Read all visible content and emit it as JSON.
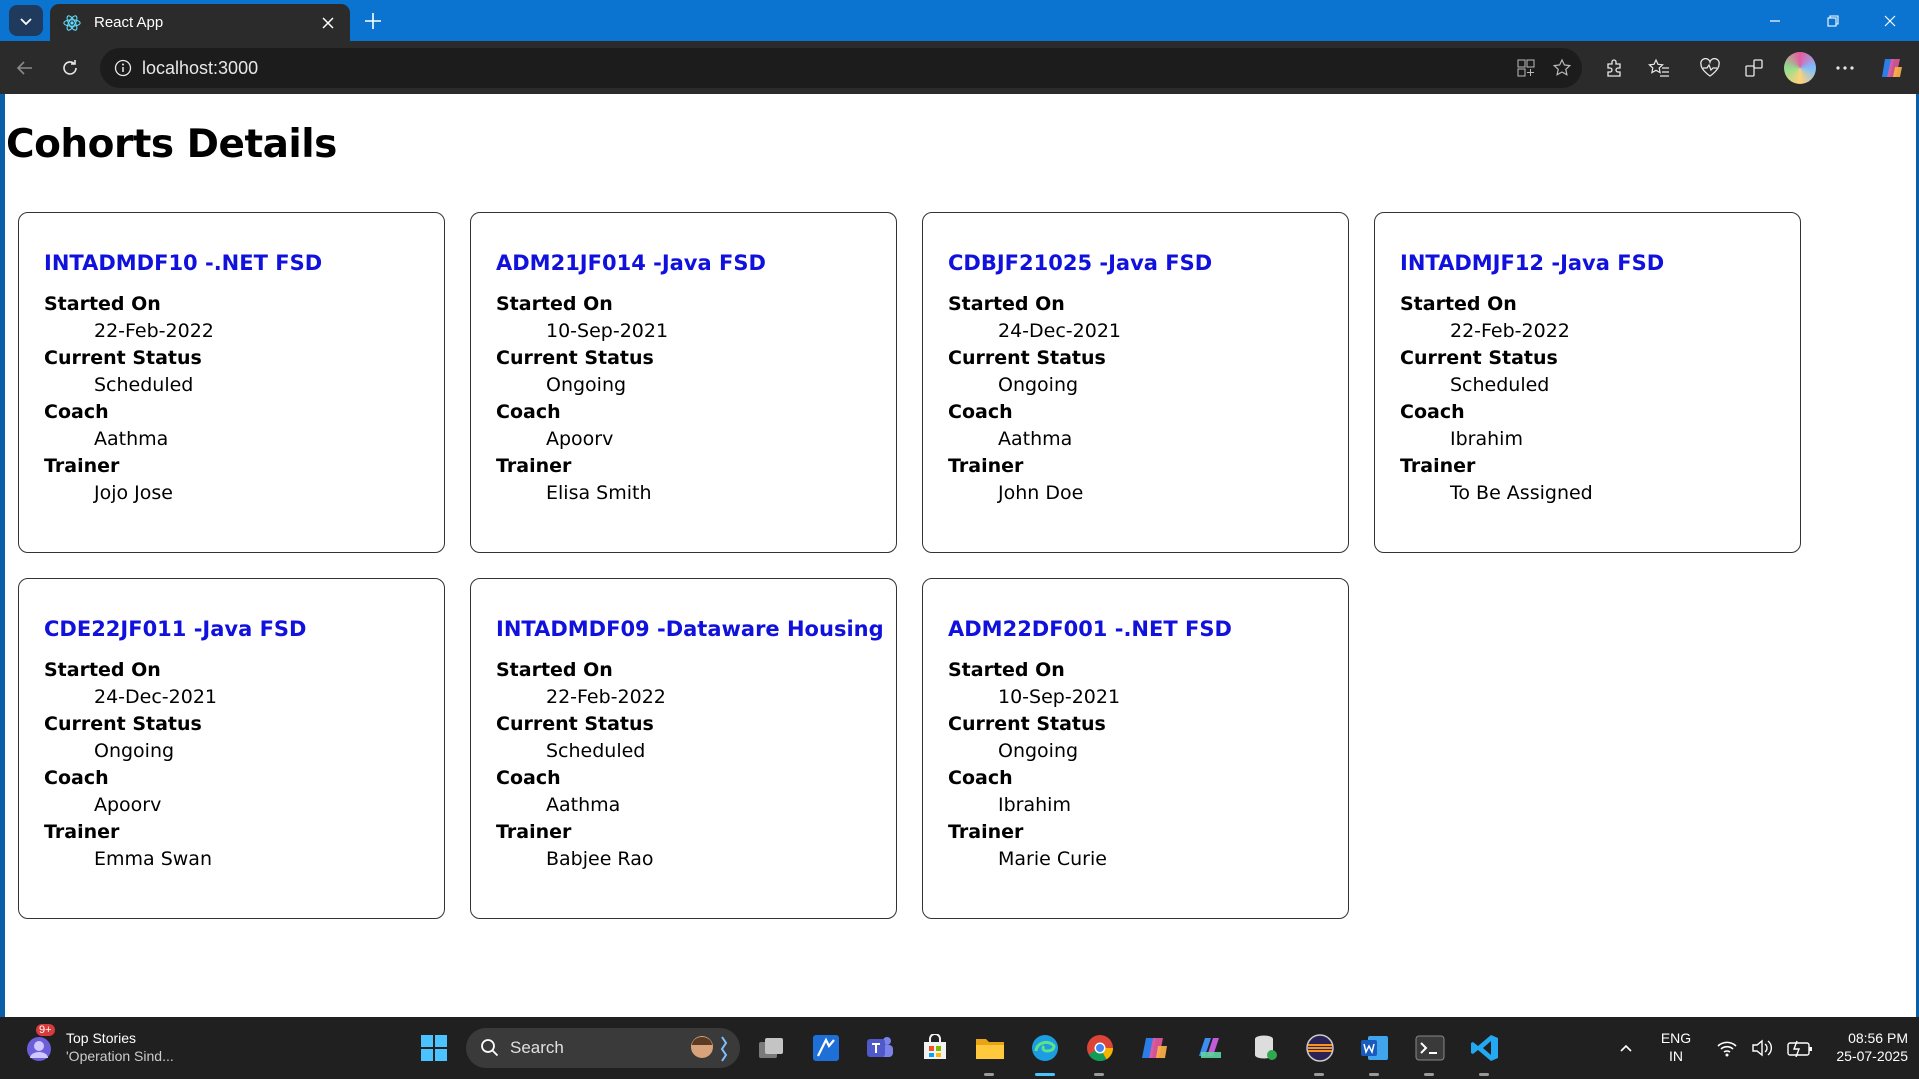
{
  "browser": {
    "tab_title": "React App",
    "url": "localhost:3000"
  },
  "page": {
    "title": "Cohorts Details",
    "labels": {
      "started_on": "Started On",
      "current_status": "Current Status",
      "coach": "Coach",
      "trainer": "Trainer"
    },
    "cohorts": [
      {
        "code": "INTADMDF10 -.NET FSD",
        "started_on": "22-Feb-2022",
        "status": "Scheduled",
        "coach": "Aathma",
        "trainer": "Jojo Jose"
      },
      {
        "code": "ADM21JF014 -Java FSD",
        "started_on": "10-Sep-2021",
        "status": "Ongoing",
        "coach": "Apoorv",
        "trainer": "Elisa Smith"
      },
      {
        "code": "CDBJF21025 -Java FSD",
        "started_on": "24-Dec-2021",
        "status": "Ongoing",
        "coach": "Aathma",
        "trainer": "John Doe"
      },
      {
        "code": "INTADMJF12 -Java FSD",
        "started_on": "22-Feb-2022",
        "status": "Scheduled",
        "coach": "Ibrahim",
        "trainer": "To Be Assigned"
      },
      {
        "code": "CDE22JF011 -Java FSD",
        "started_on": "24-Dec-2021",
        "status": "Ongoing",
        "coach": "Apoorv",
        "trainer": "Emma Swan"
      },
      {
        "code": "INTADMDF09 -Dataware Housing",
        "started_on": "22-Feb-2022",
        "status": "Scheduled",
        "coach": "Aathma",
        "trainer": "Babjee Rao"
      },
      {
        "code": "ADM22DF001 -.NET FSD",
        "started_on": "10-Sep-2021",
        "status": "Ongoing",
        "coach": "Ibrahim",
        "trainer": "Marie Curie"
      }
    ]
  },
  "taskbar": {
    "news_title": "Top Stories",
    "news_subtitle": "'Operation Sind...",
    "news_badge": "9+",
    "search_label": "Search",
    "language": "ENG",
    "region": "IN",
    "time": "08:56 PM",
    "date": "25-07-2025"
  },
  "colors": {
    "title_bar": "#0a74d0",
    "toolbar": "#2b2b2b",
    "card_title": "#1111dd",
    "taskbar": "#202020"
  }
}
